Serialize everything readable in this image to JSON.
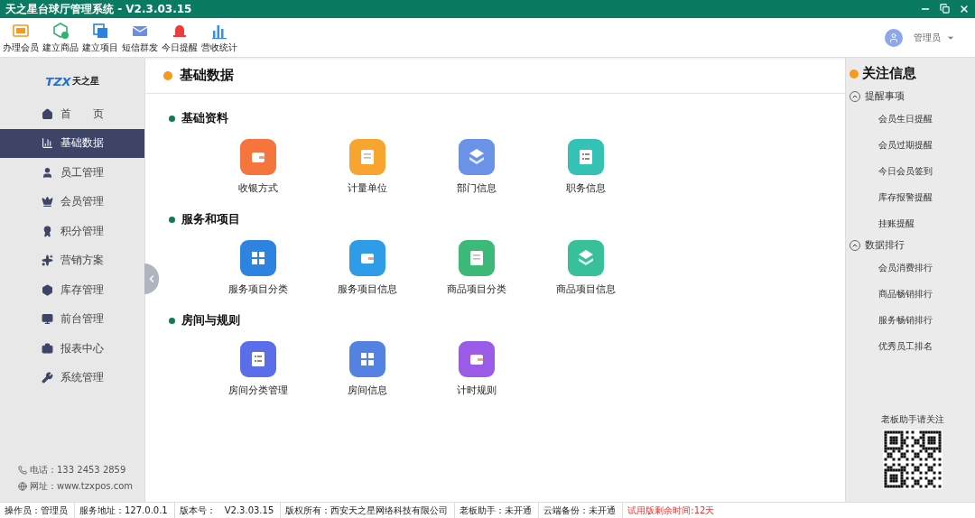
{
  "window": {
    "title": "天之星台球厅管理系统 - V2.3.03.15"
  },
  "toolbar": [
    {
      "label": "办理会员"
    },
    {
      "label": "建立商品"
    },
    {
      "label": "建立项目"
    },
    {
      "label": "短信群发"
    },
    {
      "label": "今日提醒"
    },
    {
      "label": "营收统计"
    }
  ],
  "user": {
    "name": "管理员"
  },
  "logo": {
    "mark": "TZX",
    "name": "天之星"
  },
  "sidebar": {
    "items": [
      {
        "label": "首　　页",
        "selected": false
      },
      {
        "label": "基础数据",
        "selected": true
      },
      {
        "label": "员工管理",
        "selected": false
      },
      {
        "label": "会员管理",
        "selected": false
      },
      {
        "label": "积分管理",
        "selected": false
      },
      {
        "label": "营销方案",
        "selected": false
      },
      {
        "label": "库存管理",
        "selected": false
      },
      {
        "label": "前台管理",
        "selected": false
      },
      {
        "label": "报表中心",
        "selected": false
      },
      {
        "label": "系统管理",
        "selected": false
      }
    ],
    "contacts": [
      {
        "kind": "phone",
        "text": "电话：133 2453 2859"
      },
      {
        "kind": "web",
        "text": "网址：www.tzxpos.com"
      }
    ]
  },
  "main": {
    "title": "基础数据",
    "sections": [
      {
        "title": "基础资料",
        "items": [
          {
            "label": "收银方式",
            "color": "#f5753c"
          },
          {
            "label": "计量单位",
            "color": "#f8a530"
          },
          {
            "label": "部门信息",
            "color": "#6a93e8"
          },
          {
            "label": "职务信息",
            "color": "#33c2b4"
          }
        ]
      },
      {
        "title": "服务和项目",
        "items": [
          {
            "label": "服务项目分类",
            "color": "#2d84e0"
          },
          {
            "label": "服务项目信息",
            "color": "#2f9ce8"
          },
          {
            "label": "商品项目分类",
            "color": "#3dba78"
          },
          {
            "label": "商品项目信息",
            "color": "#38c09a"
          }
        ]
      },
      {
        "title": "房间与规则",
        "items": [
          {
            "label": "房间分类管理",
            "color": "#5b6de8"
          },
          {
            "label": "房间信息",
            "color": "#5482e0"
          },
          {
            "label": "计时规则",
            "color": "#9a5ce6"
          }
        ]
      }
    ]
  },
  "focus": {
    "title": "关注信息",
    "groups": [
      {
        "title": "提醒事项",
        "expanded": true,
        "items": [
          "会员生日提醒",
          "会员过期提醒",
          "今日会员签到",
          "库存报警提醒",
          "挂账提醒"
        ]
      },
      {
        "title": "数据排行",
        "expanded": true,
        "items": [
          "会员消费排行",
          "商品畅销排行",
          "服务畅销排行",
          "优秀员工排名"
        ]
      }
    ],
    "qr_caption": "老板助手请关注"
  },
  "status_bar": [
    {
      "text": "操作员：管理员",
      "alert": false
    },
    {
      "text": "服务地址：127.0.0.1",
      "alert": false
    },
    {
      "text": "版本号：　V2.3.03.15",
      "alert": false
    },
    {
      "text": "版权所有：西安天之星网络科技有限公司",
      "alert": false
    },
    {
      "text": "老板助手：未开通",
      "alert": false
    },
    {
      "text": "云端备份：未开通",
      "alert": false
    },
    {
      "text": "试用版剩余时间:12天",
      "alert": true
    }
  ]
}
